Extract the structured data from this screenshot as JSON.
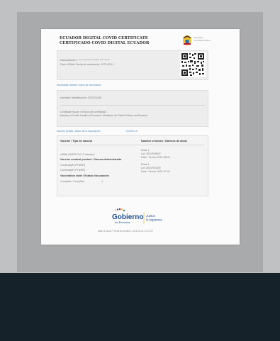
{
  "certificate": {
    "title_line1": "ECUADOR DIGITAL COVID CERTIFICATE",
    "title_line2": "CERTIFICADO COVID DIGITAL ECUADOR",
    "ministry_line1": "Ministerio",
    "ministry_line2": "de Salud Pública",
    "name_line": "Name/Nombre: *** ** ******* ******* *** ******",
    "dob_line": "Date of Birth/ Fecha de nacimiento: 1971-03-11",
    "vaccination_link": "Vaccination details / Datos de Vacunación",
    "identifier_line": "Identifier/ Identificación: 2911101045",
    "issuer_line1": "Certificate Issuer / Emisor del certificado:",
    "issuer_line2": "Ministry of Public Health of Ecuador / Ministerio de Salud Pública del Ecuador",
    "issuer_link": "Vaccine Details / Datos de la Vacunación",
    "covid_link": "COVID-19",
    "col_vaccine": "Vaccine / Tipo de vacuna",
    "col_doses": "Number of doses / Número de dosis",
    "vaccine_type": "mRNA (SARS-CoV-2 Vaccine)",
    "product_label": "Vaccine medical product / Vacuna Administrada",
    "product1": "Comirnaty® (PFIZER)",
    "product2": "Comirnaty® (PFIZER)",
    "state_label": "Vaccination state / Estado Vacunación",
    "state_value": "Complete / Completo",
    "state_check": "✓",
    "dose1_title": "Dose 1",
    "dose1_lot": "Lot: 2021FH8027",
    "dose1_date": "Date / Fecha: 2021-06-04",
    "dose2_title": "Dose 2",
    "dose2_lot": "Lot: 2021FE3039",
    "dose2_date": "Date / Fecha: 2021-07-01",
    "gov_name": "Gobierno",
    "gov_sub": "del Encuentro",
    "gov_slogan1": "Juntos",
    "gov_slogan2": "lo logramos",
    "issued_line": "Date of Issue / Fecha de emisión: 2021-09-21 11:37:22"
  },
  "colors": {
    "background_top": "#c0c1c3",
    "background_bottom": "#15222a",
    "link_blue": "#4c8fc4",
    "gov_blue": "#1d4e8f"
  },
  "icons": [
    "ecuador-coat-of-arms-icon",
    "qr-code-icon",
    "gobierno-del-encuentro-logo"
  ]
}
